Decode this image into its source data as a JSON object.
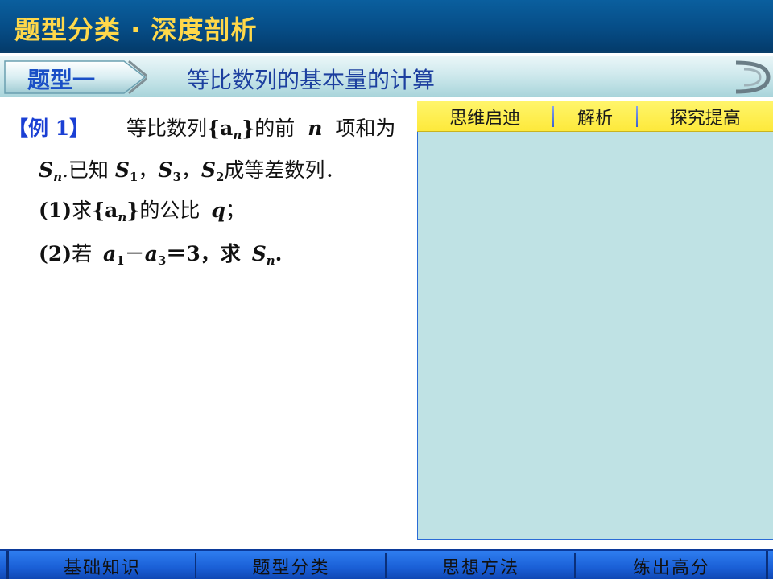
{
  "header": {
    "title": "题型分类 · 深度剖析"
  },
  "section": {
    "badge": "题型一",
    "title": "等比数列的基本量的计算"
  },
  "problem": {
    "example_label": "【例 1】",
    "line1_text": "等比数列",
    "line1_seq": "{a",
    "line1_sub": "n",
    "line1_close": "}",
    "line1_after": "的前",
    "line1_n": "n",
    "line1_end": "项和为",
    "line2_S": "S",
    "line2_n": "n",
    "line2_text": ".已知",
    "line2_S1": "S",
    "line2_1": "1",
    "line2_comma1": "，",
    "line2_S3": "S",
    "line2_3": "3",
    "line2_comma2": "，",
    "line2_S2": "S",
    "line2_2": "2",
    "line2_end": "成等差数列．",
    "q1_num": "(1)",
    "q1_text": "求",
    "q1_seq": "{a",
    "q1_sub": "n",
    "q1_close": "}",
    "q1_after": "的公比",
    "q1_q": "q",
    "q1_end": "；",
    "q2_num": "(2)",
    "q2_text": "若",
    "q2_a1": "a",
    "q2_1": "1",
    "q2_minus": "－",
    "q2_a3": "a",
    "q2_3": "3",
    "q2_eq": "＝3，求",
    "q2_S": "S",
    "q2_n": "n",
    "q2_end": "."
  },
  "tabs": [
    {
      "label": "思维启迪"
    },
    {
      "label": "解析"
    },
    {
      "label": "探究提高"
    }
  ],
  "bottom_nav": [
    {
      "label": "基础知识"
    },
    {
      "label": "题型分类"
    },
    {
      "label": "思想方法"
    },
    {
      "label": "练出高分"
    }
  ],
  "colors": {
    "header_bg": "#064d87",
    "header_text": "#ffd84a",
    "panel_bg": "#bfe2e4",
    "tab_bg": "#fde93b",
    "nav_bg": "#1a5fd6",
    "example_label": "#1a3fd4"
  }
}
